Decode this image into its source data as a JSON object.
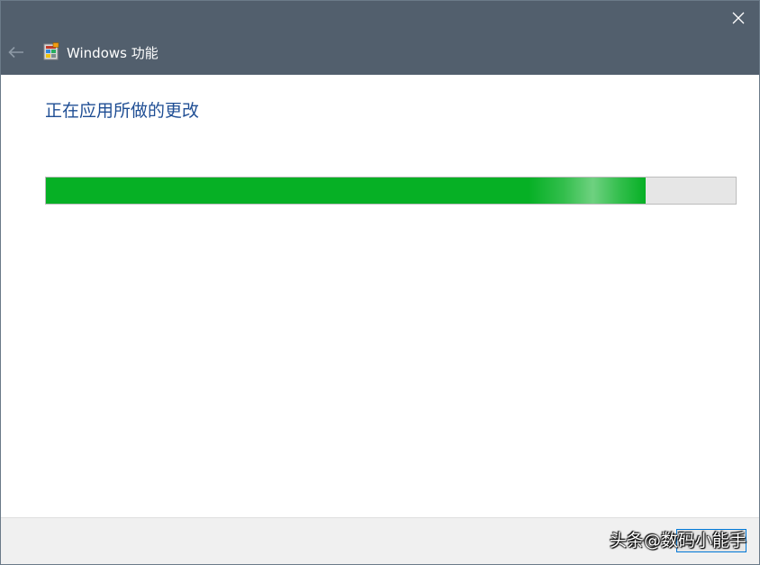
{
  "window": {
    "title": "Windows 功能",
    "heading": "正在应用所做的更改"
  },
  "progress": {
    "value_percent": 87
  },
  "footer": {
    "watermark": "头条@数码小能手"
  },
  "colors": {
    "titlebar": "#525f6d",
    "heading": "#1f4e94",
    "progress_fill": "#06b025",
    "progress_track": "#e6e6e6",
    "footer": "#f0f0f0"
  },
  "icons": {
    "close": "close-icon",
    "back": "back-arrow-icon",
    "app": "windows-features-icon"
  }
}
